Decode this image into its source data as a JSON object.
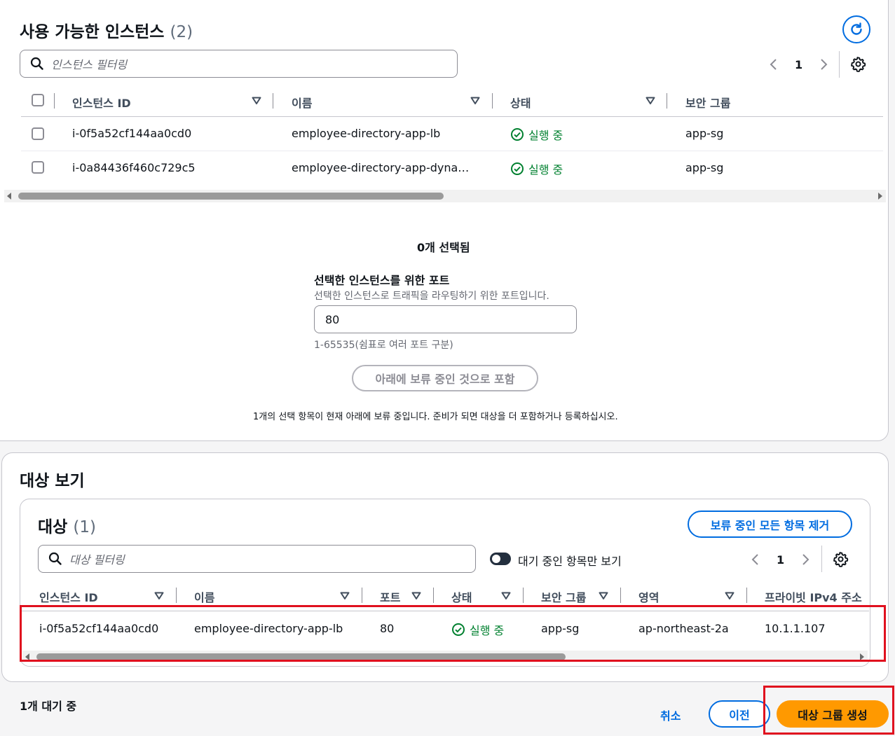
{
  "instances": {
    "title": "사용 가능한 인스턴스",
    "count": "(2)",
    "search_placeholder": "인스턴스 필터링",
    "page": "1",
    "columns": [
      "인스턴스 ID",
      "이름",
      "상태",
      "보안 그룹"
    ],
    "rows": [
      {
        "id": "i-0f5a52cf144aa0cd0",
        "name": "employee-directory-app-lb",
        "status": "실행 중",
        "sg": "app-sg"
      },
      {
        "id": "i-0a84436f460c729c5",
        "name": "employee-directory-app-dyna…",
        "status": "실행 중",
        "sg": "app-sg"
      }
    ]
  },
  "selection": {
    "selected_count": "0개 선택됨",
    "port_label": "선택한 인스턴스를 위한 포트",
    "port_desc": "선택한 인스턴스로 트래픽을 라우팅하기 위한 포트입니다.",
    "port_value": "80",
    "port_hint": "1-65535(쉼표로 여러 포트 구분)",
    "include_button": "아래에 보류 중인 것으로 포함",
    "pending_note": "1개의 선택 항목이 현재 아래에 보류 중입니다. 준비가 되면 대상을 더 포함하거나 등록하십시오."
  },
  "review": {
    "title": "대상 보기",
    "targets_title": "대상",
    "targets_count": "(1)",
    "remove_button": "보류 중인 모든 항목 제거",
    "search_placeholder": "대상 필터링",
    "toggle_label": "대기 중인 항목만 보기",
    "page": "1",
    "columns": [
      "인스턴스 ID",
      "이름",
      "포트",
      "상태",
      "보안 그룹",
      "영역",
      "프라이빗 IPv4 주소"
    ],
    "row": {
      "id": "i-0f5a52cf144aa0cd0",
      "name": "employee-directory-app-lb",
      "port": "80",
      "status": "실행 중",
      "sg": "app-sg",
      "zone": "ap-northeast-2a",
      "ip": "10.1.1.107"
    }
  },
  "footer": {
    "pending": "1개 대기 중",
    "cancel": "취소",
    "previous": "이전",
    "create": "대상 그룹 생성"
  },
  "colors": {
    "accent": "#006ce0",
    "primary": "#ff9900",
    "success": "#00802f",
    "highlight": "#e0101e"
  }
}
